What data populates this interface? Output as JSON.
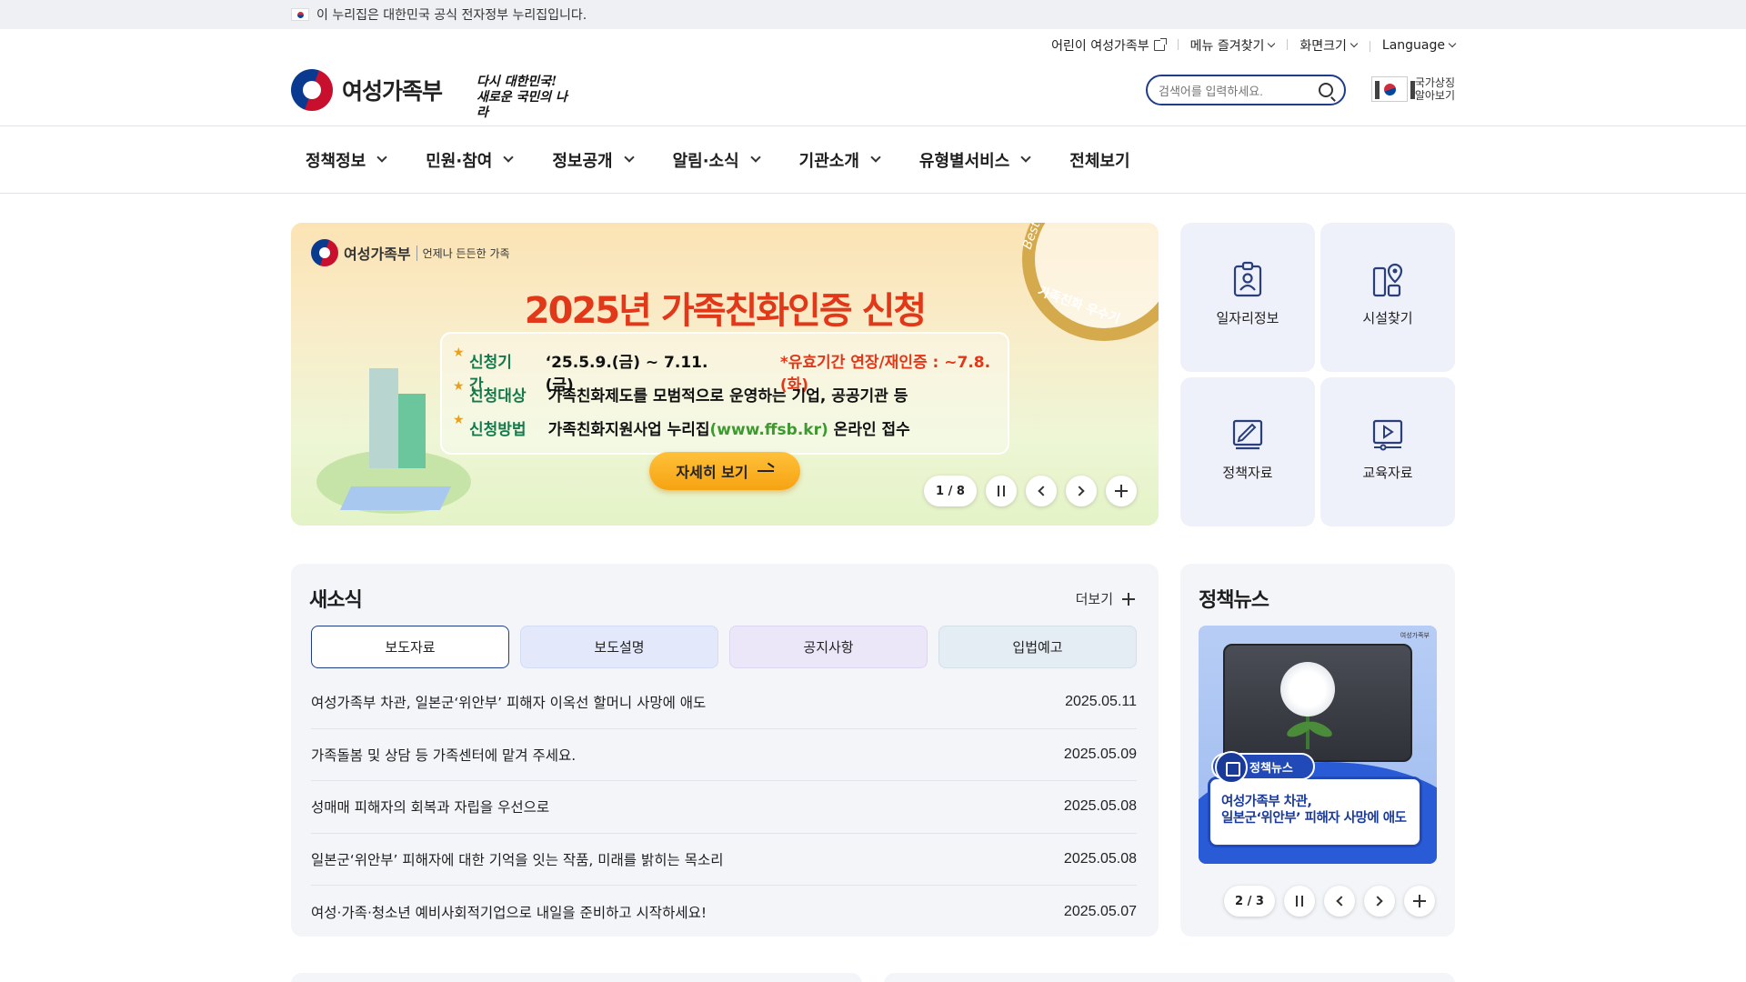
{
  "gov_banner": {
    "text": "이 누리집은 대한민국 공식 전자정부 누리집입니다."
  },
  "utility": {
    "kids": "어린이 여성가족부",
    "favorites": "메뉴 즐겨찾기",
    "screen_size": "화면크기",
    "language": "Language"
  },
  "logo": {
    "text": "여성가족부",
    "slogan_line1": "다시 대한민국!",
    "slogan_line2": "새로운 국민의 나라"
  },
  "search": {
    "placeholder": "검색어를 입력하세요."
  },
  "national_symbols": {
    "line1": "국가상징",
    "line2": "알아보기"
  },
  "gnb": {
    "items": [
      {
        "label": "정책정보"
      },
      {
        "label": "민원·참여"
      },
      {
        "label": "정보공개"
      },
      {
        "label": "알림·소식"
      },
      {
        "label": "기관소개"
      },
      {
        "label": "유형별서비스"
      },
      {
        "label": "전체보기"
      }
    ]
  },
  "hero": {
    "org": "여성가족부",
    "org_sub": "언제나 든든한 가족",
    "title": "2025년 가족친화인증 신청",
    "rows": [
      {
        "key": "신청기간",
        "value": "‘25.5.9.(금) ~ 7.11.(금)",
        "extra": "*유효기간 연장/재인증 : ~7.8.(화)"
      },
      {
        "key": "신청대상",
        "value": "가족친화제도를 모범적으로 운영하는 기업, 공공기관 등"
      },
      {
        "key": "신청방법",
        "value_pre": "가족친화지원사업 누리집",
        "value_url": "(www.ffsb.kr)",
        "value_post": " 온라인 접수"
      }
    ],
    "button": "자세히 보기",
    "badge_best": "Best",
    "badge_text": "가족친화 우수기",
    "pager": "1 / 8"
  },
  "quick": [
    {
      "label": "일자리정보",
      "icon": "id-card-icon"
    },
    {
      "label": "시설찾기",
      "icon": "location-pin-icon"
    },
    {
      "label": "정책자료",
      "icon": "document-edit-icon"
    },
    {
      "label": "교육자료",
      "icon": "video-play-icon"
    }
  ],
  "news": {
    "title": "새소식",
    "more": "더보기",
    "tabs": [
      {
        "label": "보도자료",
        "color": "#ffffff",
        "active": true
      },
      {
        "label": "보도설명",
        "color": "#e3e9fb"
      },
      {
        "label": "공지사항",
        "color": "#ece7f8"
      },
      {
        "label": "입법예고",
        "color": "#e4edf3"
      }
    ],
    "items": [
      {
        "title": "여성가족부 차관, 일본군‘위안부’ 피해자 이옥선 할머니 사망에 애도",
        "date": "2025.05.11"
      },
      {
        "title": "가족돌봄 및 상담 등 가족센터에 맡겨 주세요.",
        "date": "2025.05.09"
      },
      {
        "title": "성매매 피해자의 회복과 자립을 우선으로",
        "date": "2025.05.08"
      },
      {
        "title": "일본군‘위안부’ 피해자에 대한 기억을 잇는 작품, 미래를 밝히는 목소리",
        "date": "2025.05.08"
      },
      {
        "title": "여성·가족·청소년 예비사회적기업으로 내일을 준비하고 시작하세요!",
        "date": "2025.05.07"
      }
    ]
  },
  "policy_news": {
    "title": "정책뉴스",
    "card_logo": "여성가족부",
    "badge": "정책뉴스",
    "caption_line1": "여성가족부 차관,",
    "caption_line2": "일본군‘위안부’ 피해자 사망에 애도",
    "pager": "2 / 3"
  },
  "colors": {
    "primary": "#1f3c88",
    "hero_title": "#e2381a",
    "hero_key": "#147a4c",
    "panel_bg": "#f3f5f9",
    "quick_bg": "#eef0fa"
  }
}
